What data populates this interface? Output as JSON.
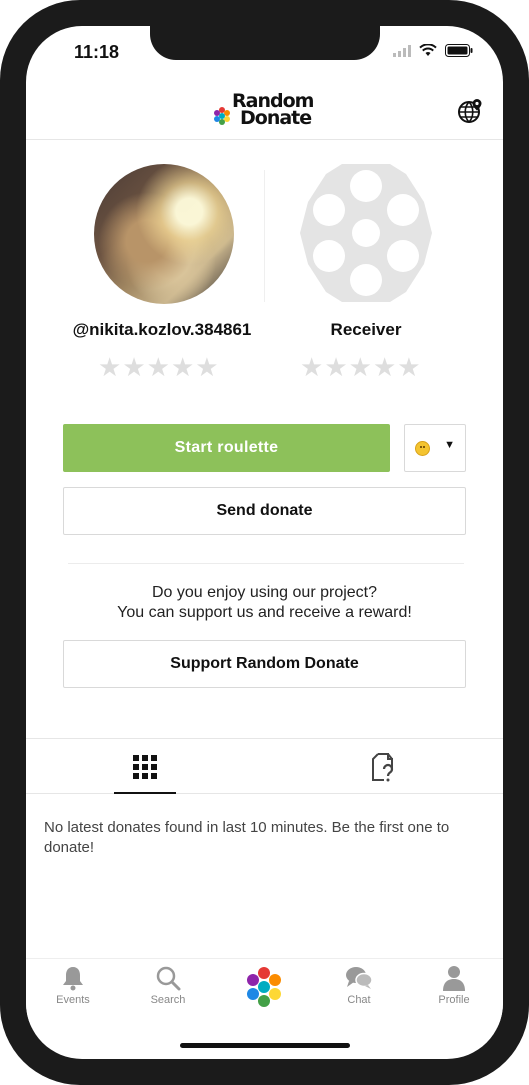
{
  "status_bar": {
    "time": "11:18"
  },
  "header": {
    "logo_line1": "Random",
    "logo_line2": "Donate",
    "globe_icon": "globe-pin-icon"
  },
  "sender": {
    "username": "@nikita.kozlov.384861",
    "rating": 0,
    "max_rating": 5
  },
  "receiver": {
    "label": "Receiver",
    "rating": 0,
    "max_rating": 5
  },
  "actions": {
    "start_roulette": "Start roulette",
    "send_donate": "Send donate",
    "support": "Support Random Donate"
  },
  "emoji_selector": {
    "icon": "smiley-icon"
  },
  "promo": {
    "line1": "Do you enjoy using our project?",
    "line2": "You can support us and receive a reward!"
  },
  "tabs": [
    {
      "icon": "grid-icon",
      "active": true
    },
    {
      "icon": "question-document-icon",
      "active": false
    }
  ],
  "feed": {
    "empty_message": "No latest donates found in last 10 minutes. Be the first one to donate!"
  },
  "bottom_nav": {
    "items": [
      {
        "label": "Events",
        "icon": "bell-icon"
      },
      {
        "label": "Search",
        "icon": "search-icon"
      },
      {
        "label": "",
        "icon": "hex-logo-icon"
      },
      {
        "label": "Chat",
        "icon": "chat-bubbles-icon"
      },
      {
        "label": "Profile",
        "icon": "user-icon"
      }
    ]
  },
  "colors": {
    "accent_green": "#8dc15a",
    "star_empty": "#dedede",
    "label_gray": "#888888"
  }
}
